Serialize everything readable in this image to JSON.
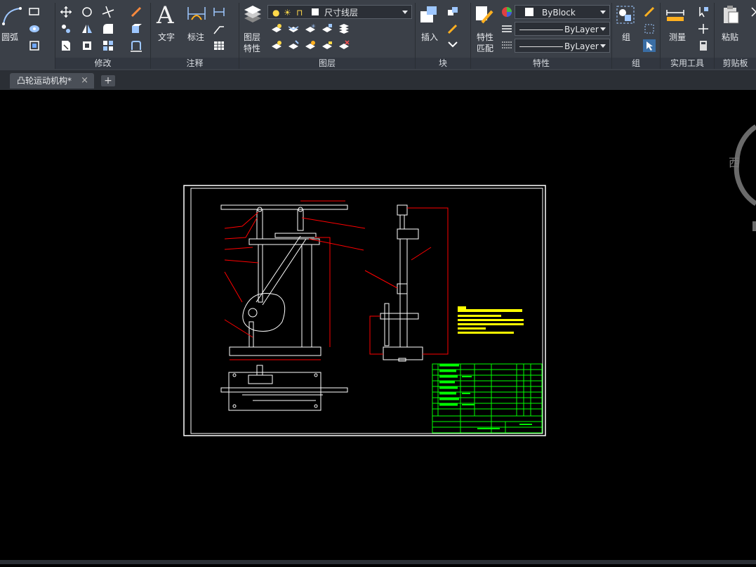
{
  "ribbon": {
    "panels": {
      "draw": {
        "arc_label": "圆弧"
      },
      "modify": {
        "title": "修改"
      },
      "annotation": {
        "title": "注释",
        "text_label": "文字",
        "dimension_label": "标注",
        "text_glyph": "A"
      },
      "layers": {
        "title": "图层",
        "layer_props_label_1": "图层",
        "layer_props_label_2": "特性",
        "current_layer": "尺寸线层"
      },
      "block": {
        "title": "块",
        "insert_label": "插入"
      },
      "properties": {
        "title": "特性",
        "match_label_1": "特性",
        "match_label_2": "匹配",
        "color_value": "ByBlock",
        "linetype_value": "ByLayer",
        "lineweight_value": "ByLayer"
      },
      "groups": {
        "title": "组",
        "group_label": "组"
      },
      "utilities": {
        "title": "实用工具",
        "measure_label": "测量"
      },
      "clipboard": {
        "title": "剪贴板",
        "paste_label": "粘贴"
      }
    }
  },
  "tabs": {
    "active": "凸轮运动机构*",
    "close_glyph": "×",
    "new_glyph": "+"
  },
  "viewcube": {
    "direction": "西"
  },
  "colors": {
    "ribbon_bg": "#3b4048",
    "canvas_bg": "#000000",
    "drawing_white": "#ffffff",
    "dimension_red": "#ff0000",
    "title_block_green": "#00ff00",
    "notes_yellow": "#ffff00"
  }
}
